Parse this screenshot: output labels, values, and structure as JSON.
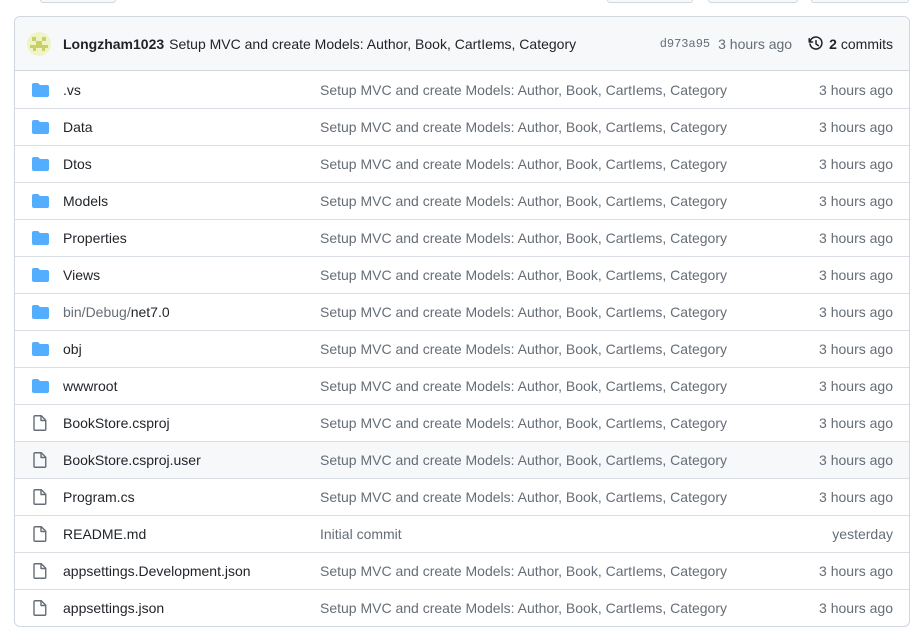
{
  "colors": {
    "folder": "#54aeff",
    "file": "#656d76",
    "border": "#d0d7de",
    "header_bg": "#f6f8fa",
    "muted_text": "#656d76",
    "text": "#1f2328"
  },
  "latest_commit": {
    "avatar_icon": "identicon-avatar",
    "author": "Longzham1023",
    "message": "Setup MVC and create Models: Author, Book, CartIems, Category",
    "sha": "d973a95",
    "time": "3 hours ago",
    "history_icon": "history-icon",
    "commits_count": "2",
    "commits_label": "commits"
  },
  "files": [
    {
      "type": "dir",
      "icon": "folder-icon",
      "name": ".vs",
      "message": "Setup MVC and create Models: Author, Book, CartIems, Category",
      "age": "3 hours ago"
    },
    {
      "type": "dir",
      "icon": "folder-icon",
      "name": "Data",
      "message": "Setup MVC and create Models: Author, Book, CartIems, Category",
      "age": "3 hours ago"
    },
    {
      "type": "dir",
      "icon": "folder-icon",
      "name": "Dtos",
      "message": "Setup MVC and create Models: Author, Book, CartIems, Category",
      "age": "3 hours ago"
    },
    {
      "type": "dir",
      "icon": "folder-icon",
      "name": "Models",
      "message": "Setup MVC and create Models: Author, Book, CartIems, Category",
      "age": "3 hours ago"
    },
    {
      "type": "dir",
      "icon": "folder-icon",
      "name": "Properties",
      "message": "Setup MVC and create Models: Author, Book, CartIems, Category",
      "age": "3 hours ago"
    },
    {
      "type": "dir",
      "icon": "folder-icon",
      "name": "Views",
      "message": "Setup MVC and create Models: Author, Book, CartIems, Category",
      "age": "3 hours ago"
    },
    {
      "type": "dir",
      "icon": "folder-icon",
      "name_prefix": "bin/Debug/",
      "name": "net7.0",
      "message": "Setup MVC and create Models: Author, Book, CartIems, Category",
      "age": "3 hours ago"
    },
    {
      "type": "dir",
      "icon": "folder-icon",
      "name": "obj",
      "message": "Setup MVC and create Models: Author, Book, CartIems, Category",
      "age": "3 hours ago"
    },
    {
      "type": "dir",
      "icon": "folder-icon",
      "name": "wwwroot",
      "message": "Setup MVC and create Models: Author, Book, CartIems, Category",
      "age": "3 hours ago"
    },
    {
      "type": "file",
      "icon": "file-icon",
      "name": "BookStore.csproj",
      "message": "Setup MVC and create Models: Author, Book, CartIems, Category",
      "age": "3 hours ago"
    },
    {
      "type": "file",
      "icon": "file-icon",
      "name": "BookStore.csproj.user",
      "message": "Setup MVC and create Models: Author, Book, CartIems, Category",
      "age": "3 hours ago",
      "hovered": true
    },
    {
      "type": "file",
      "icon": "file-icon",
      "name": "Program.cs",
      "message": "Setup MVC and create Models: Author, Book, CartIems, Category",
      "age": "3 hours ago"
    },
    {
      "type": "file",
      "icon": "file-icon",
      "name": "README.md",
      "message": "Initial commit",
      "age": "yesterday"
    },
    {
      "type": "file",
      "icon": "file-icon",
      "name": "appsettings.Development.json",
      "message": "Setup MVC and create Models: Author, Book, CartIems, Category",
      "age": "3 hours ago"
    },
    {
      "type": "file",
      "icon": "file-icon",
      "name": "appsettings.json",
      "message": "Setup MVC and create Models: Author, Book, CartIems, Category",
      "age": "3 hours ago"
    }
  ]
}
